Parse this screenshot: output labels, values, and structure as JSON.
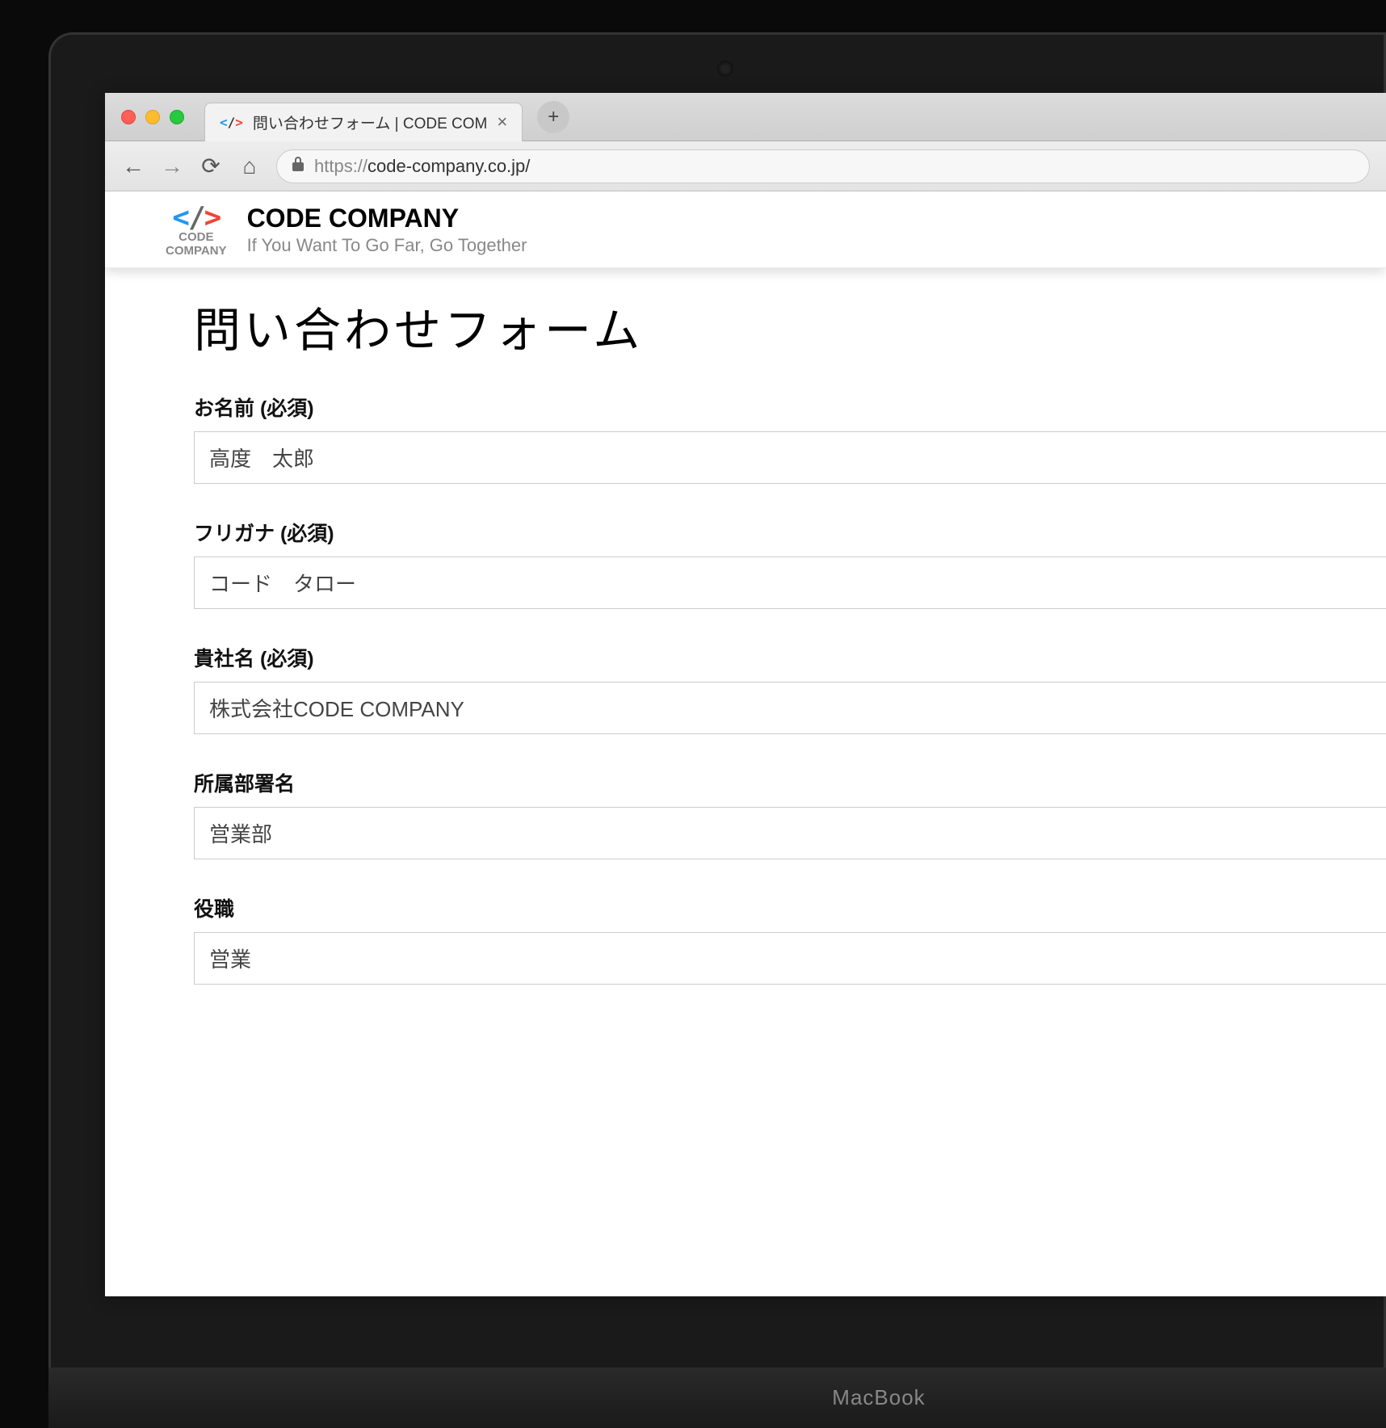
{
  "browser": {
    "tab_title": "問い合わせフォーム | CODE COM",
    "url_protocol": "https://",
    "url_host": "code-company.co.jp/"
  },
  "site": {
    "logo_text_line1": "CODE",
    "logo_text_line2": "COMPANY",
    "brand_name": "CODE COMPANY",
    "tagline": "If You Want To Go Far, Go Together"
  },
  "page": {
    "title": "問い合わせフォーム"
  },
  "form": {
    "fields": [
      {
        "label": "お名前 (必須)",
        "value": "高度　太郎"
      },
      {
        "label": "フリガナ (必須)",
        "value": "コード　タロー"
      },
      {
        "label": "貴社名 (必須)",
        "value": "株式会社CODE COMPANY"
      },
      {
        "label": "所属部署名",
        "value": "営業部"
      },
      {
        "label": "役職",
        "value": "営業"
      }
    ]
  },
  "device": {
    "label": "MacBook"
  }
}
